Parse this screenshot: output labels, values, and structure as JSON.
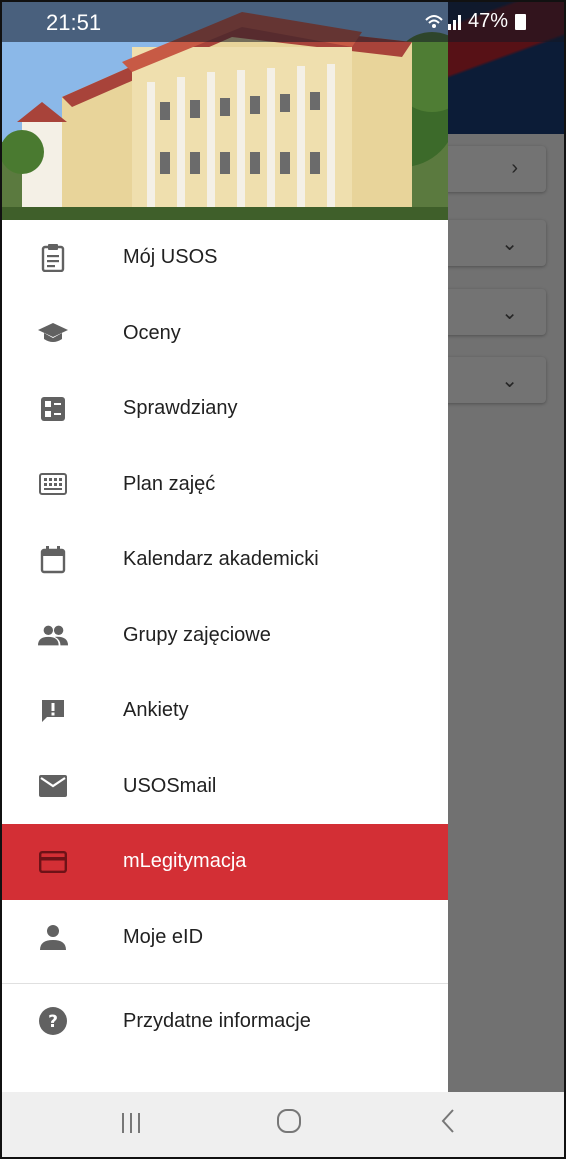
{
  "status_bar": {
    "time": "21:51",
    "battery": "47%",
    "signal_icon": "wifi-signal-icon"
  },
  "drawer": {
    "header_image": "university-building-photo",
    "items": [
      {
        "label": "Mój USOS",
        "icon": "clipboard-icon"
      },
      {
        "label": "Oceny",
        "icon": "graduation-cap-icon"
      },
      {
        "label": "Sprawdziany",
        "icon": "checklist-icon"
      },
      {
        "label": "Plan zajęć",
        "icon": "keyboard-grid-icon"
      },
      {
        "label": "Kalendarz akademicki",
        "icon": "calendar-icon"
      },
      {
        "label": "Grupy zajęciowe",
        "icon": "people-icon"
      },
      {
        "label": "Ankiety",
        "icon": "feedback-icon"
      },
      {
        "label": "USOSmail",
        "icon": "mail-icon"
      },
      {
        "label": "mLegitymacja",
        "icon": "card-icon",
        "active": true
      },
      {
        "label": "Moje eID",
        "icon": "person-icon"
      }
    ],
    "footer_item": {
      "label": "Przydatne informacje",
      "icon": "help-icon"
    }
  },
  "colors": {
    "active_bg": "#d32f35",
    "icon": "#616161",
    "text": "#212121"
  },
  "nav_bar": {
    "recent": "recent-apps-icon",
    "home": "home-icon",
    "back": "back-icon"
  }
}
